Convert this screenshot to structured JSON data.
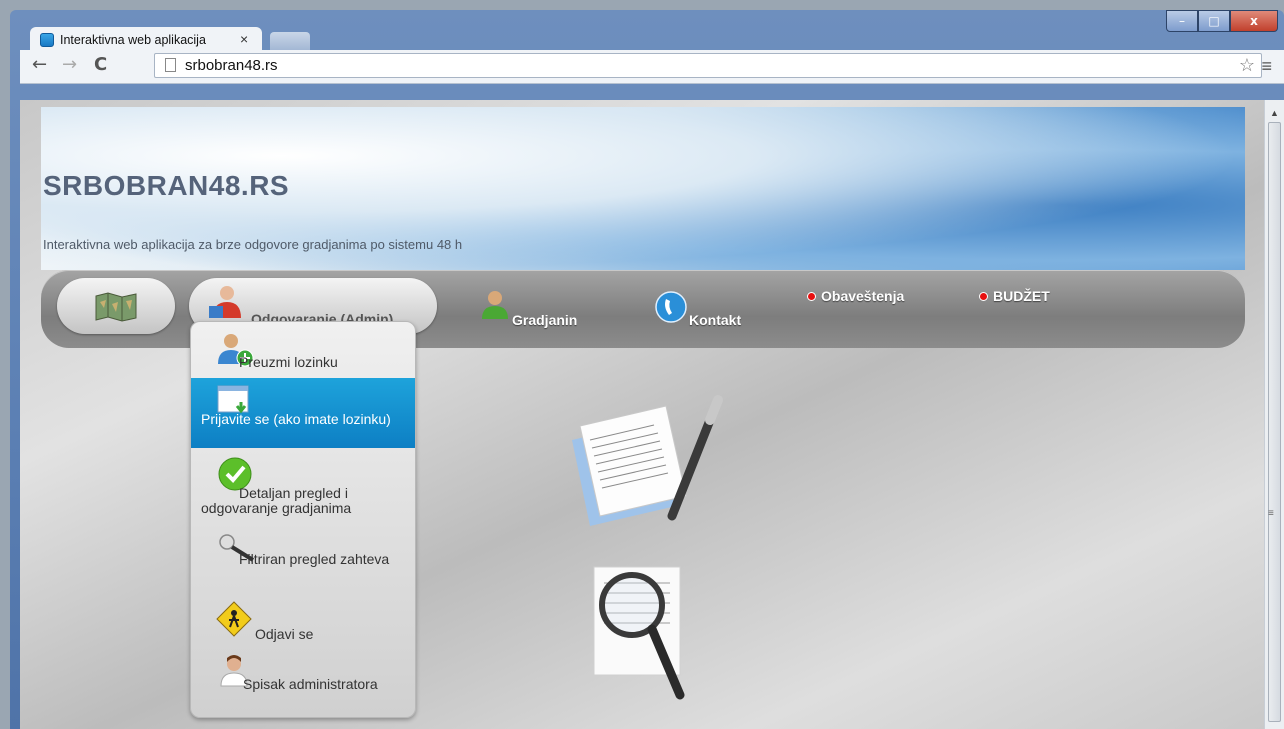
{
  "browser": {
    "tab_title": "Interaktivna web aplikacija",
    "tab_close": "×",
    "url": "srbobran48.rs"
  },
  "window": {
    "minimize": "–",
    "maximize": "□",
    "close": "x"
  },
  "site": {
    "title": "SRBOBRAN48.RS",
    "tagline": "Interaktivna web aplikacija za brze odgovore gradjanima po sistemu 48 h"
  },
  "nav": {
    "admin_label": "Odgovaranje (Admin)",
    "citizen_label": "Gradjanin",
    "contact_label": "Kontakt",
    "notices_label": "Obaveštenja",
    "budget_label": "BUDŽET"
  },
  "dropdown": {
    "items": [
      {
        "label": "Preuzmi lozinku",
        "icon": "user-add-icon"
      },
      {
        "label": "Prijavite se (ako imate lozinku)",
        "icon": "login-window-icon",
        "active": true
      },
      {
        "label": "Detaljan pregled i odgovaranje gradjanima",
        "icon": "green-check-icon"
      },
      {
        "label": "Filtriran pregled zahteva",
        "icon": "magnifier-icon"
      },
      {
        "label": "Odjavi se",
        "icon": "warning-sign-icon"
      },
      {
        "label": "Spisak administratora",
        "icon": "admin-user-icon"
      }
    ]
  },
  "colors": {
    "accent": "#0d8fd0",
    "notice_dot": "#e81010"
  }
}
